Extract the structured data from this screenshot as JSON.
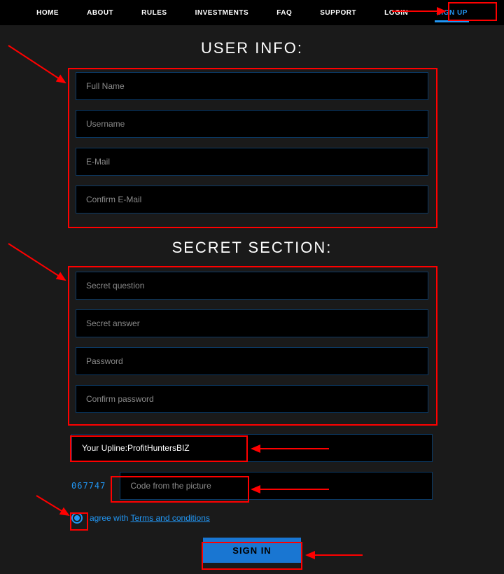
{
  "nav": {
    "home": "HOME",
    "about": "ABOUT",
    "rules": "RULES",
    "investments": "INVESTMENTS",
    "faq": "FAQ",
    "support": "SUPPORT",
    "login": "LOGIN",
    "signup": "SIGN UP"
  },
  "headings": {
    "userinfo": "USER INFO:",
    "secret": "SECRET SECTION:"
  },
  "ph": {
    "fullname": "Full Name",
    "username": "Username",
    "email": "E-Mail",
    "cemail": "Confirm E-Mail",
    "sq": "Secret question",
    "sa": "Secret answer",
    "pw": "Password",
    "cpw": "Confirm password",
    "code": "Code from the picture"
  },
  "upline": {
    "label": "Your Upline: ",
    "value": "ProfitHuntersBIZ"
  },
  "captcha": "067747",
  "agree": {
    "text": "agree with ",
    "link": "Terms and conditions"
  },
  "button": "SIGN IN"
}
